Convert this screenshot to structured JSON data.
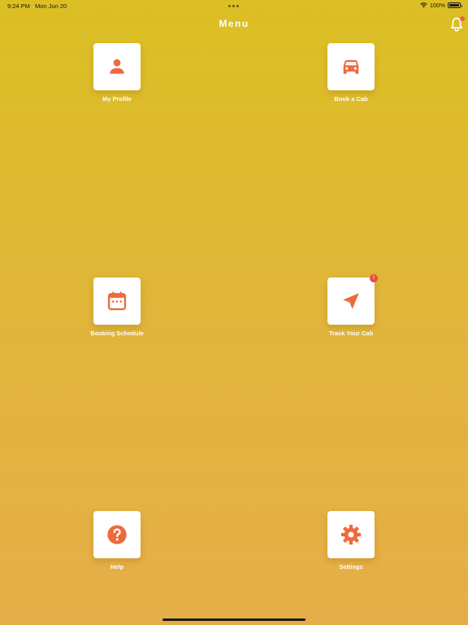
{
  "status_bar": {
    "time": "9:24 PM",
    "date": "Mon Jun 20",
    "battery": "100%"
  },
  "header": {
    "title": "Menu",
    "notification_icon": "bell-icon"
  },
  "colors": {
    "accent": "#f0693c",
    "tile_background": "#ffffff",
    "badge": "#ef4a3c"
  },
  "menu": {
    "items": [
      {
        "label": "My Profile",
        "icon": "person-icon"
      },
      {
        "label": "Book a Cab",
        "icon": "car-icon"
      },
      {
        "label": "Booking Schedule",
        "icon": "calendar-icon"
      },
      {
        "label": "Track Your Cab",
        "icon": "navigation-arrow-icon",
        "badge": "!"
      },
      {
        "label": "Help",
        "icon": "help-circle-icon"
      },
      {
        "label": "Settings",
        "icon": "gear-icon"
      }
    ]
  }
}
